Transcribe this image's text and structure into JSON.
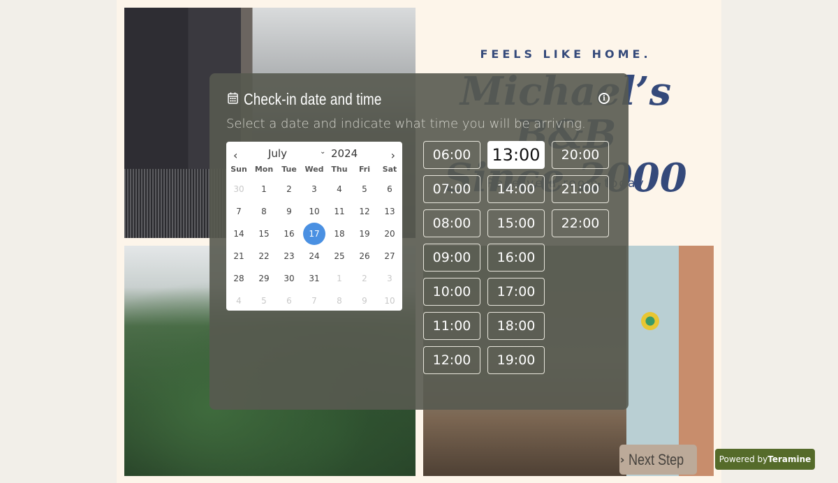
{
  "hero": {
    "tagline": "FEELS LIKE HOME.",
    "title_line1": "Michael’s B&B",
    "title_line2": "Since 2000",
    "subtitle": "Reserve a room today"
  },
  "modal": {
    "icon": "calendar-icon",
    "title": "Check-in date and time",
    "subtitle": "Select a date and indicate what time you will be arriving.",
    "info_icon": "info-icon"
  },
  "calendar": {
    "prev_label": "‹",
    "next_label": "›",
    "month": "July",
    "month_caret": "⌄",
    "year": "2024",
    "weekdays": [
      "Sun",
      "Mon",
      "Tue",
      "Wed",
      "Thu",
      "Fri",
      "Sat"
    ],
    "weeks": [
      [
        {
          "d": "30",
          "m": true
        },
        {
          "d": "1"
        },
        {
          "d": "2"
        },
        {
          "d": "3"
        },
        {
          "d": "4"
        },
        {
          "d": "5"
        },
        {
          "d": "6"
        }
      ],
      [
        {
          "d": "7"
        },
        {
          "d": "8"
        },
        {
          "d": "9"
        },
        {
          "d": "10"
        },
        {
          "d": "11"
        },
        {
          "d": "12"
        },
        {
          "d": "13"
        }
      ],
      [
        {
          "d": "14"
        },
        {
          "d": "15"
        },
        {
          "d": "16"
        },
        {
          "d": "17",
          "s": true
        },
        {
          "d": "18"
        },
        {
          "d": "19"
        },
        {
          "d": "20"
        }
      ],
      [
        {
          "d": "21"
        },
        {
          "d": "22"
        },
        {
          "d": "23"
        },
        {
          "d": "24"
        },
        {
          "d": "25"
        },
        {
          "d": "26"
        },
        {
          "d": "27"
        }
      ],
      [
        {
          "d": "28"
        },
        {
          "d": "29"
        },
        {
          "d": "30"
        },
        {
          "d": "31"
        },
        {
          "d": "1",
          "m": true
        },
        {
          "d": "2",
          "m": true
        },
        {
          "d": "3",
          "m": true
        }
      ],
      [
        {
          "d": "4",
          "m": true
        },
        {
          "d": "5",
          "m": true
        },
        {
          "d": "6",
          "m": true
        },
        {
          "d": "7",
          "m": true
        },
        {
          "d": "8",
          "m": true
        },
        {
          "d": "9",
          "m": true
        },
        {
          "d": "10",
          "m": true
        }
      ]
    ],
    "selected_date": "17",
    "selected_color": "#4a90e2"
  },
  "times": {
    "slots": [
      "06:00",
      "07:00",
      "08:00",
      "09:00",
      "10:00",
      "11:00",
      "12:00",
      "13:00",
      "14:00",
      "15:00",
      "16:00",
      "17:00",
      "18:00",
      "19:00",
      "20:00",
      "21:00",
      "22:00"
    ],
    "selected": "13:00"
  },
  "next_step": {
    "icon": "chevron-right-icon",
    "label": "Next Step"
  },
  "powered_by": {
    "prefix": "Powered by",
    "brand": "Teramine",
    "color": "#556b2a"
  }
}
